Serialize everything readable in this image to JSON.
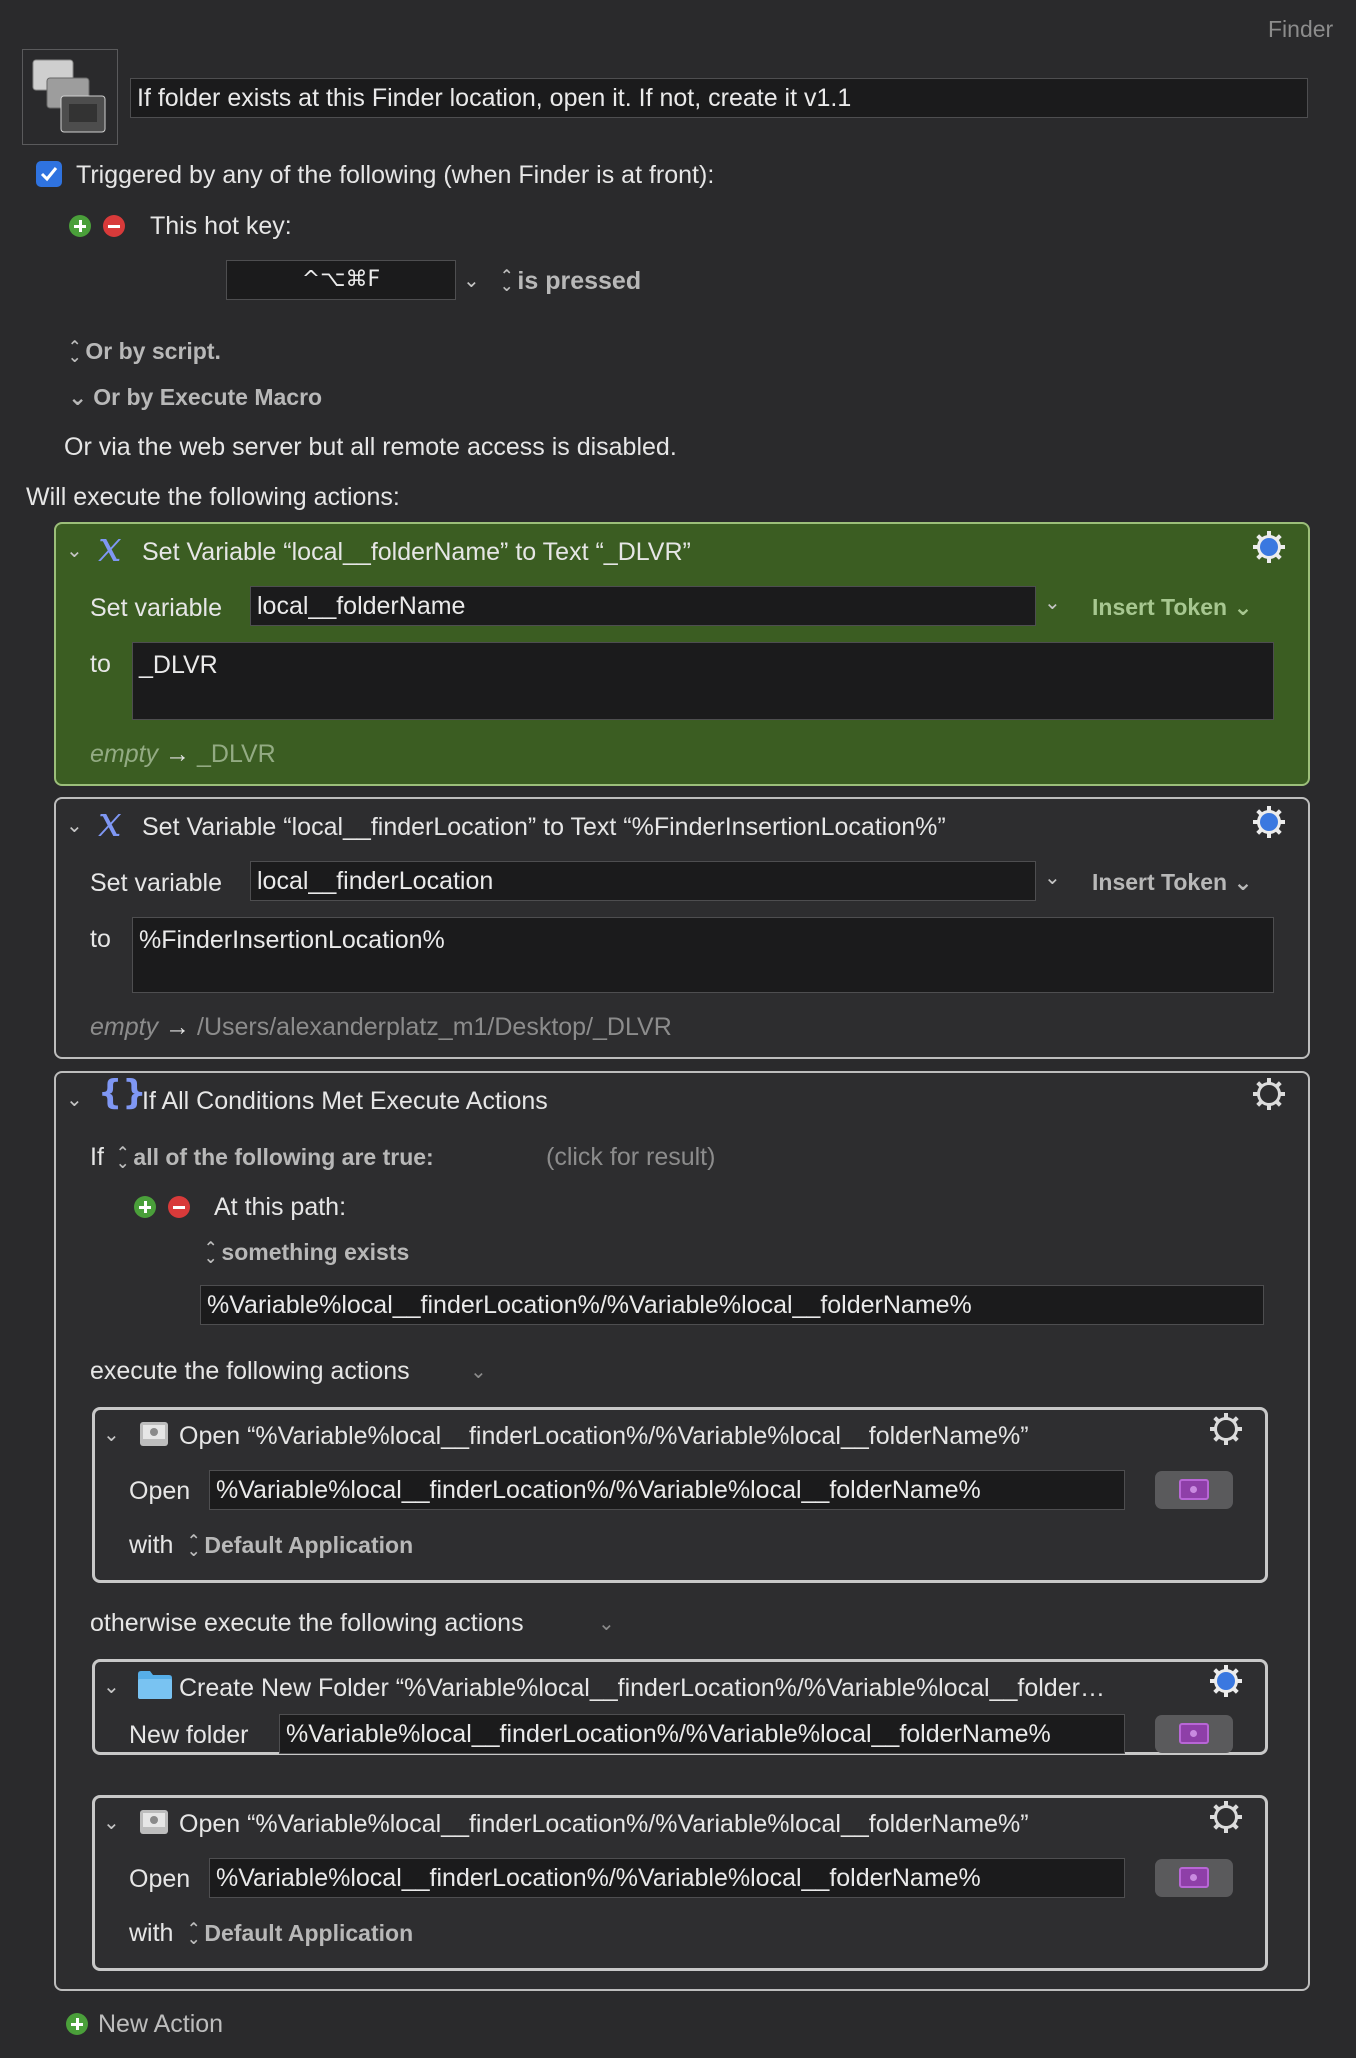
{
  "window": {
    "app": "Finder"
  },
  "macro": {
    "name": "If folder exists at this Finder location, open it. If not, create it v1.1",
    "trigger_label": "Triggered by any of the following (when Finder is at front):",
    "hotkey_label": "This hot key:",
    "hotkey_value": "^⌥⌘F",
    "hotkey_state": "is pressed",
    "or_by_script": "Or by script.",
    "or_by_execute_macro": "Or by Execute Macro",
    "web_server_note": "Or via the web server but all remote access is disabled.",
    "will_execute": "Will execute the following actions:",
    "new_action": "New Action"
  },
  "actions": {
    "set1": {
      "title": "Set Variable “local__folderName” to Text “_DLVR”",
      "set_label": "Set variable",
      "variable": "local__folderName",
      "insert_token": "Insert Token",
      "to_label": "to",
      "value": "_DLVR",
      "preview_empty": "empty",
      "preview_arrow": "→",
      "preview_value": "_DLVR"
    },
    "set2": {
      "title": "Set Variable “local__finderLocation” to Text “%FinderInsertionLocation%”",
      "set_label": "Set variable",
      "variable": "local__finderLocation",
      "insert_token": "Insert Token",
      "to_label": "to",
      "value": "%FinderInsertionLocation%",
      "preview_empty": "empty",
      "preview_arrow": "→",
      "preview_value": "/Users/alexanderplatz_m1/Desktop/_DLVR"
    },
    "ifblock": {
      "title": "If All Conditions Met Execute Actions",
      "if_label": "If",
      "condition_mode": "all of the following are true:",
      "click_result": "(click for result)",
      "path_label": "At this path:",
      "path_condition": "something exists",
      "path_value": "%Variable%local__finderLocation%/%Variable%local__folderName%",
      "execute_label": "execute the following actions",
      "otherwise_label": "otherwise execute the following actions",
      "open1": {
        "title": "Open “%Variable%local__finderLocation%/%Variable%local__folderName%”",
        "open_label": "Open",
        "path": "%Variable%local__finderLocation%/%Variable%local__folderName%",
        "with_label": "with",
        "app": "Default Application"
      },
      "create": {
        "title": "Create New Folder “%Variable%local__finderLocation%/%Variable%local__folder…",
        "label": "New folder",
        "path": "%Variable%local__finderLocation%/%Variable%local__folderName%"
      },
      "open2": {
        "title": "Open “%Variable%local__finderLocation%/%Variable%local__folderName%”",
        "open_label": "Open",
        "path": "%Variable%local__finderLocation%/%Variable%local__folderName%",
        "with_label": "with",
        "app": "Default Application"
      }
    }
  },
  "colors": {
    "enabled_gear": "#3a78e0",
    "green_block": "#3b5d22",
    "token_icon": "#7f97f4"
  }
}
